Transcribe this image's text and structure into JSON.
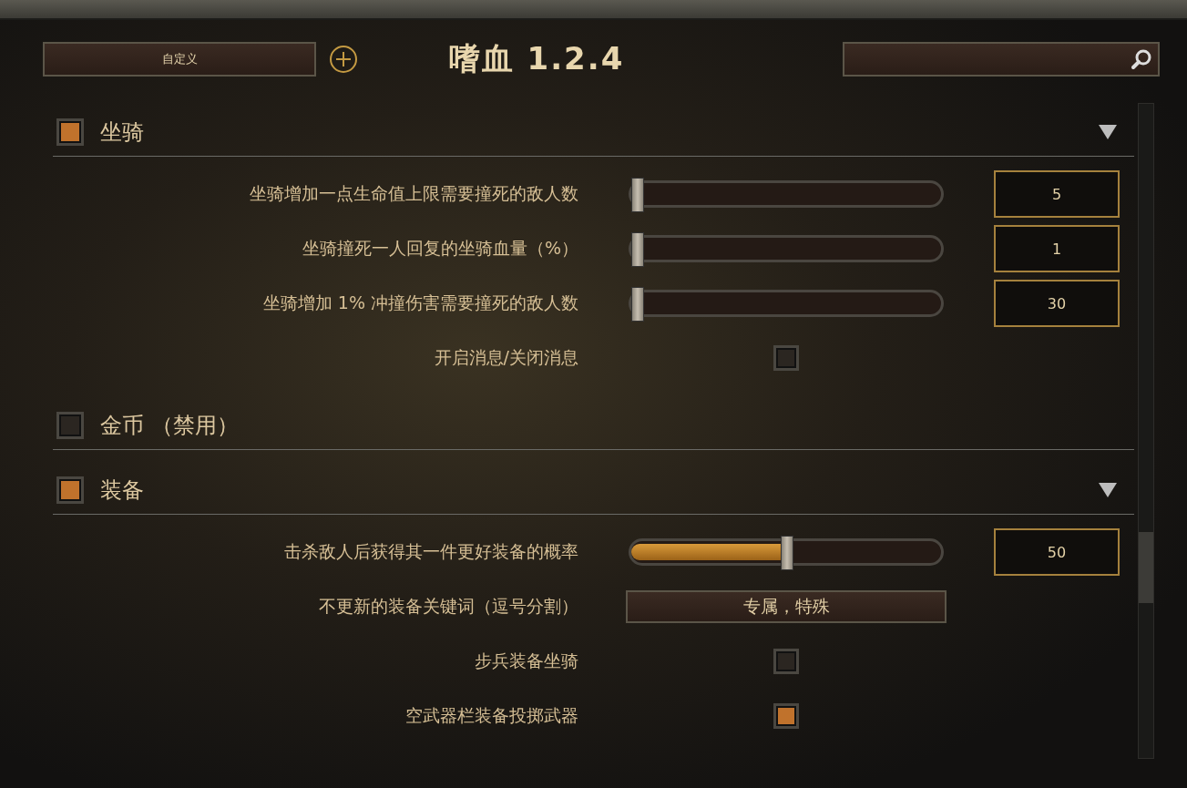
{
  "header": {
    "preset_button": "自定义",
    "title": "嗜血 1.2.4"
  },
  "sections": [
    {
      "title": "坐骑",
      "enabled": true,
      "expanded": true,
      "rows": [
        {
          "kind": "slider",
          "label": "坐骑增加一点生命值上限需要撞死的敌人数",
          "level": 0,
          "value": "5"
        },
        {
          "kind": "slider",
          "label": "坐骑撞死一人回复的坐骑血量（%）",
          "level": 0,
          "value": "1"
        },
        {
          "kind": "slider",
          "label": "坐骑增加 1% 冲撞伤害需要撞死的敌人数",
          "level": 0,
          "value": "30"
        },
        {
          "kind": "checkbox",
          "label": "开启消息/关闭消息",
          "checked": false
        }
      ]
    },
    {
      "title": "金币 （禁用）",
      "enabled": false,
      "expanded": false
    },
    {
      "title": "装备",
      "enabled": true,
      "expanded": true,
      "rows": [
        {
          "kind": "slider",
          "label": "击杀敌人后获得其一件更好装备的概率",
          "level": 0.5,
          "value": "50"
        },
        {
          "kind": "text",
          "label": "不更新的装备关键词（逗号分割）",
          "value": "专属，特殊"
        },
        {
          "kind": "checkbox",
          "label": "步兵装备坐骑",
          "checked": false
        },
        {
          "kind": "checkbox",
          "label": "空武器栏装备投掷武器",
          "checked": true
        }
      ]
    }
  ]
}
